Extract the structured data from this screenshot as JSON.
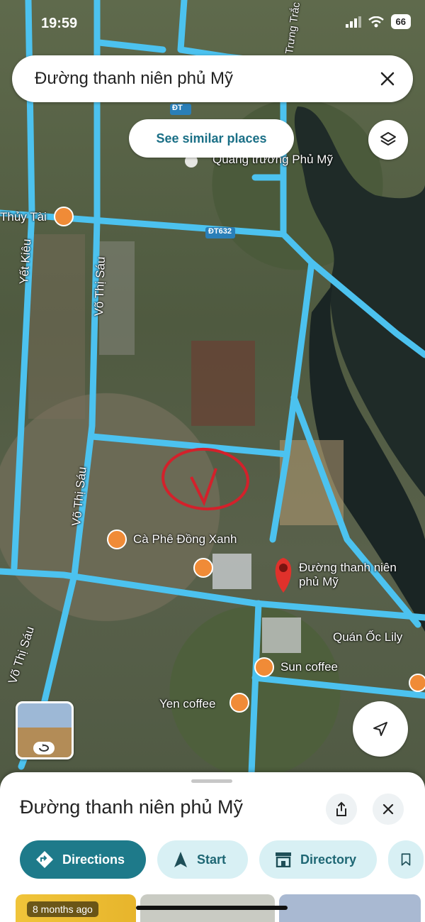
{
  "status_bar": {
    "time": "19:59",
    "battery": "66"
  },
  "search": {
    "query": "Đường thanh niên phủ Mỹ"
  },
  "chips": {
    "similar_places": "See similar places"
  },
  "map_labels": {
    "square": "Quảng trường Phủ Mỹ",
    "thuy_tai": "Thủy Tài",
    "yet_kieu": "Yết Kiêu",
    "vo_thi_sau_1": "Võ Thị Sáu",
    "vo_thi_sau_2": "Võ Thị Sáu",
    "vo_thi_sau_3": "Võ Thị Sáu",
    "road_dt632": "ĐT632",
    "road_dt": "ĐT",
    "trung_trac": "Trưng Trắc",
    "cafe_dong_xanh": "Cà Phê Đồng Xanh",
    "pin_label": "Đường thanh niên phủ Mỹ",
    "quan_oc_lily": "Quán Ốc Lily",
    "sun_coffee": "Sun coffee",
    "yen_coffee": "Yen coffee",
    "annotation_mark": "V"
  },
  "sheet": {
    "title": "Đường thanh niên phủ Mỹ",
    "actions": {
      "directions": "Directions",
      "start": "Start",
      "directory": "Directory"
    },
    "photo_age": "8 months ago"
  },
  "icons": {
    "signal": "signal-icon",
    "wifi": "wifi-icon",
    "close": "close-icon",
    "layers": "layers-icon",
    "location": "navigation-arrow-icon",
    "share": "share-icon",
    "save": "bookmark-icon"
  },
  "colors": {
    "road": "#4cc2ef",
    "accent": "#1e7a8a",
    "pin": "#e0312b",
    "annotation": "#d3212b"
  }
}
